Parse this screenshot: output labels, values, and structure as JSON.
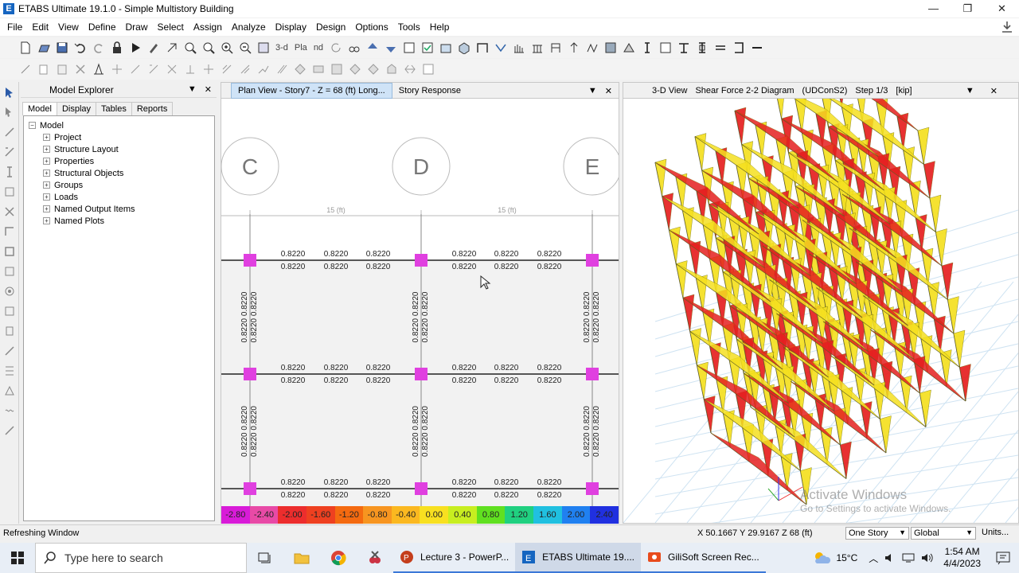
{
  "window": {
    "title": "ETABS Ultimate 19.1.0 - Simple Multistory Building",
    "app_icon": "E",
    "minimize": "—",
    "restore": "❐",
    "close": "✕"
  },
  "menu": [
    "File",
    "Edit",
    "View",
    "Define",
    "Draw",
    "Select",
    "Assign",
    "Analyze",
    "Display",
    "Design",
    "Options",
    "Tools",
    "Help"
  ],
  "toolbar": {
    "view_3d": "3-d",
    "plan": "Pla",
    "elev": "nd"
  },
  "model_explorer": {
    "title": "Model Explorer",
    "tabs": [
      "Model",
      "Display",
      "Tables",
      "Reports"
    ],
    "root": "Model",
    "items": [
      "Project",
      "Structure Layout",
      "Properties",
      "Structural Objects",
      "Groups",
      "Loads",
      "Named Output Items",
      "Named Plots"
    ]
  },
  "plan_view": {
    "tab_active": "Plan View - Story7 - Z = 68 (ft)  Long...",
    "tab_other": "Story Response",
    "grid_labels": [
      "C",
      "D",
      "E"
    ],
    "dimension_label": "15 (ft)",
    "member_value": "0.8220",
    "colorbar": [
      "-2.80",
      "-2.40",
      "-2.00",
      "-1.60",
      "-1.20",
      "-0.80",
      "-0.40",
      "0.00",
      "0.40",
      "0.80",
      "1.20",
      "1.60",
      "2.00",
      "2.40"
    ],
    "colorbar_colors": [
      "#d81bd8",
      "#e84aa6",
      "#ec2d2d",
      "#ee4020",
      "#f46a10",
      "#f79520",
      "#fbb820",
      "#f8e020",
      "#c8ee20",
      "#60e020",
      "#20d080",
      "#20c0e0",
      "#2080f0",
      "#2030e0"
    ]
  },
  "view3d": {
    "title_parts": [
      "3-D View",
      "Shear Force 2-2 Diagram",
      "(UDConS2)",
      "Step 1/3",
      "[kip]"
    ],
    "watermark_title": "Activate Windows",
    "watermark_sub": "Go to Settings to activate Windows."
  },
  "status": {
    "text": "Refreshing Window",
    "coords": "X 50.1667  Y 29.9167  Z 68 (ft)",
    "story_select": "One Story",
    "coord_select": "Global",
    "units": "Units..."
  },
  "taskbar": {
    "search_placeholder": "Type here to search",
    "apps": [
      "Lecture 3 - PowerP...",
      "ETABS Ultimate 19....",
      "GiliSoft Screen Rec..."
    ],
    "temperature": "15°C",
    "time": "1:54 AM",
    "date": "4/4/2023"
  }
}
